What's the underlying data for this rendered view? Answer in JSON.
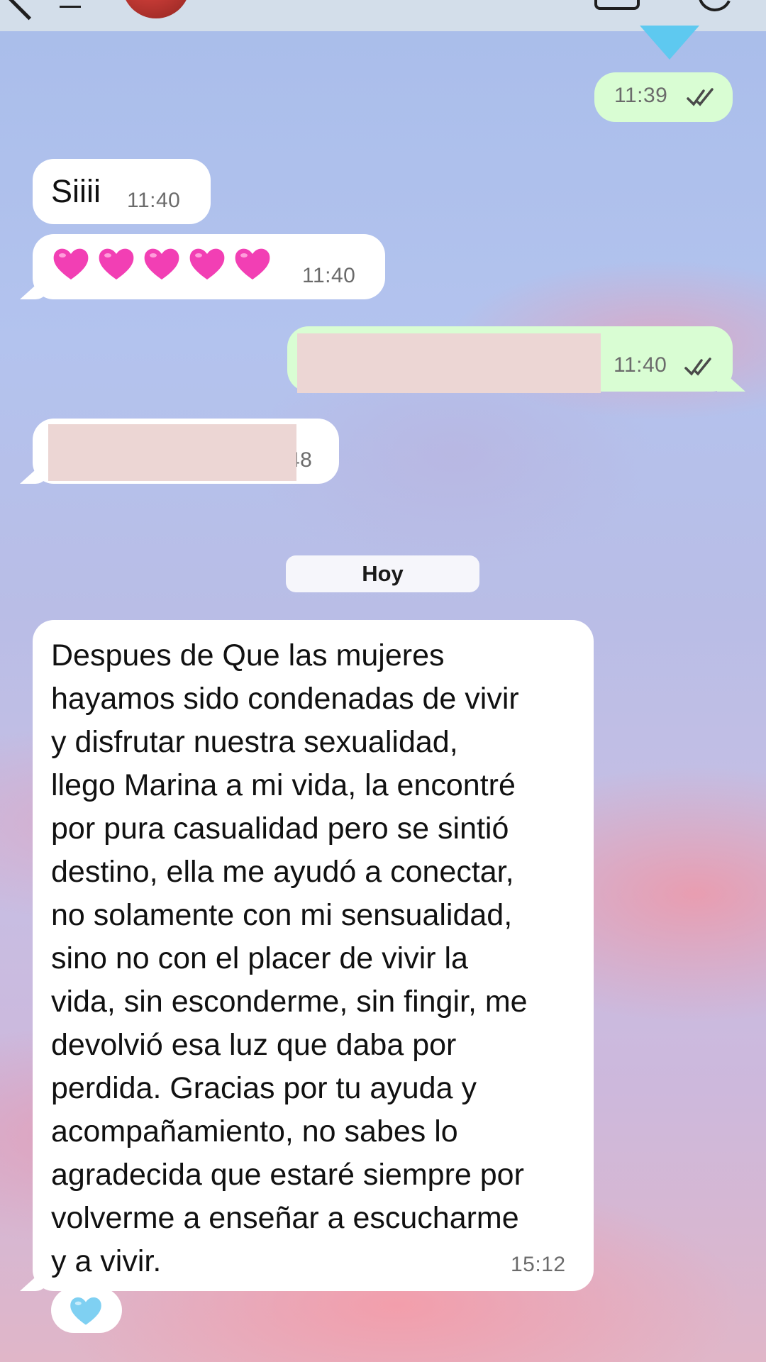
{
  "colors": {
    "incoming_bubble": "#ffffff",
    "outgoing_bubble": "#d9fdd3",
    "heart": "#f23fb4",
    "reaction_heart": "#7fd0f2",
    "read_ticks": "#4a4a4a"
  },
  "header": {
    "back_icon": "chevron-left-icon",
    "menu_icon": "lines-icon",
    "avatar": "contact-avatar",
    "title": "",
    "video_icon": "video-call-icon",
    "call_icon": "phone-call-icon"
  },
  "messages": [
    {
      "id": "m1",
      "direction": "out",
      "text": "",
      "time": "11:39",
      "status": "read"
    },
    {
      "id": "m2",
      "direction": "in",
      "text": "Siiii",
      "time": "11:40"
    },
    {
      "id": "m3",
      "direction": "in",
      "emoji": [
        "pink-heart",
        "pink-heart",
        "pink-heart",
        "pink-heart",
        "pink-heart"
      ],
      "time": "11:40"
    },
    {
      "id": "m4",
      "direction": "out",
      "redacted": true,
      "time": "11:40",
      "status": "read"
    },
    {
      "id": "m5",
      "direction": "in",
      "redacted": true,
      "time": "48"
    }
  ],
  "day_separator": "Hoy",
  "long_message": {
    "lines": [
      "Despues de Que las mujeres",
      "hayamos sido condenadas de vivir",
      "y disfrutar nuestra sexualidad,",
      "llego Marina a mi vida, la encontré",
      "por pura casualidad pero se sintió",
      "destino, ella me ayudó a conectar,",
      "no solamente con mi sensualidad,",
      "sino no con el placer de vivir la",
      "vida, sin esconderme, sin fingir, me",
      "devolvió esa luz que daba por",
      "perdida. Gracias por tu ayuda y",
      "acompañamiento, no sabes lo",
      "agradecida que estaré siempre por",
      "volverme a enseñar a escucharme",
      "y a vivir."
    ],
    "time": "15:12",
    "reaction": "light-blue-heart"
  }
}
